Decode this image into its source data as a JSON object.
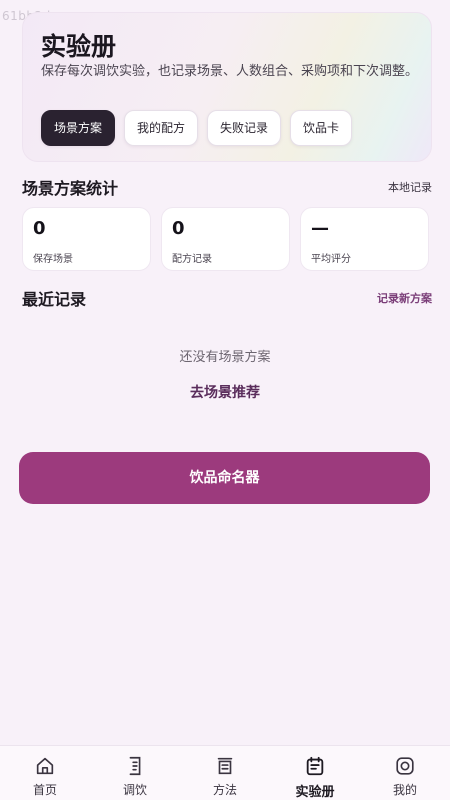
{
  "watermark": "61bb2d",
  "hero": {
    "title": "实验册",
    "description": "保存每次调饮实验，也记录场景、人数组合、采购项和下次调整。",
    "chips": [
      {
        "label": "场景方案",
        "active": true
      },
      {
        "label": "我的配方",
        "active": false
      },
      {
        "label": "失败记录",
        "active": false
      },
      {
        "label": "饮品卡",
        "active": false
      }
    ]
  },
  "stats_section": {
    "title": "场景方案统计",
    "link": "本地记录",
    "items": [
      {
        "value": "0",
        "label": "保存场景"
      },
      {
        "value": "0",
        "label": "配方记录"
      },
      {
        "value": "—",
        "label": "平均评分"
      }
    ]
  },
  "recent_section": {
    "title": "最近记录",
    "link": "记录新方案",
    "empty_text": "还没有场景方案",
    "empty_link": "去场景推荐"
  },
  "primary_button": "饮品命名器",
  "tabbar": {
    "items": [
      {
        "label": "首页",
        "icon": "home-icon"
      },
      {
        "label": "调饮",
        "icon": "recipe-icon"
      },
      {
        "label": "方法",
        "icon": "method-icon"
      },
      {
        "label": "实验册",
        "icon": "lab-notebook-icon",
        "active": true
      },
      {
        "label": "我的",
        "icon": "profile-icon"
      }
    ]
  },
  "colors": {
    "accent": "#9c3a7d",
    "chip_active": "#2a2230",
    "background": "#f8f1f9"
  }
}
